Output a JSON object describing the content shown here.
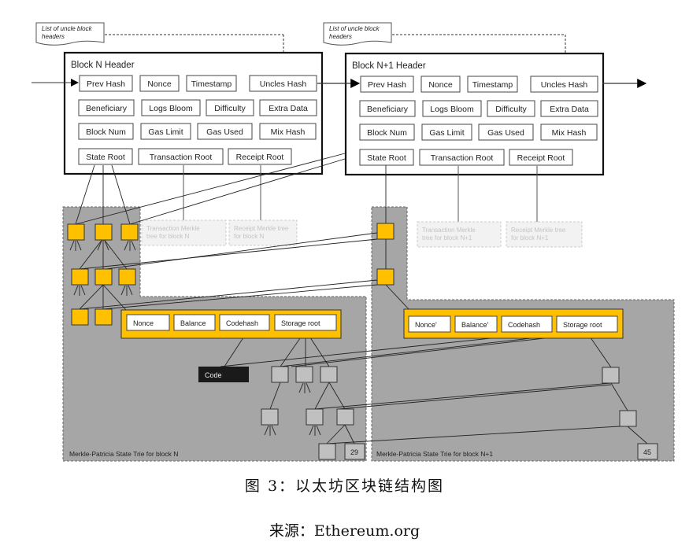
{
  "notes": [
    {
      "lines": [
        "List of uncle block",
        "headers"
      ]
    },
    {
      "lines": [
        "List of uncle block",
        "headers"
      ]
    }
  ],
  "blocks": [
    {
      "title": "Block N Header",
      "fields": [
        "Prev Hash",
        "Nonce",
        "Timestamp",
        "Uncles Hash",
        "Beneficiary",
        "Logs Bloom",
        "Difficulty",
        "Extra Data",
        "Block Num",
        "Gas Limit",
        "Gas Used",
        "Mix Hash",
        "State Root",
        "Transaction Root",
        "Receipt Root"
      ]
    },
    {
      "title": "Block N+1 Header",
      "fields": [
        "Prev Hash",
        "Nonce",
        "Timestamp",
        "Uncles Hash",
        "Beneficiary",
        "Logs Bloom",
        "Difficulty",
        "Extra Data",
        "Block Num",
        "Gas Limit",
        "Gas Used",
        "Mix Hash",
        "State Root",
        "Transaction Root",
        "Receipt Root"
      ]
    }
  ],
  "merkle_boxes": [
    {
      "lines": [
        "Transaction Merkle",
        "tree for block N"
      ]
    },
    {
      "lines": [
        "Receipt Merkle tree",
        "for block N"
      ]
    },
    {
      "lines": [
        "Transaction Merkle",
        "tree for block N+1"
      ]
    },
    {
      "lines": [
        "Receipt Merkle tree",
        "for block N+1"
      ]
    }
  ],
  "accounts": [
    [
      "Nonce",
      "Balance",
      "Codehash",
      "Storage root"
    ],
    [
      "Nonce'",
      "Balance'",
      "Codehash",
      "Storage root"
    ]
  ],
  "code_label": "Code",
  "leaf_values": [
    "29",
    "45"
  ],
  "trie_labels": [
    "Merkle-Patricia  State Trie for block N",
    "Merkle-Patricia  State Trie for block N+1"
  ],
  "caption": "图 3：以太坊区块链结构图",
  "source": "来源：Ethereum.org",
  "colors": {
    "trie_bg": "#a6a6a6",
    "node_orange": "#ffc000",
    "node_gray": "#c0c0c0",
    "code_bg": "#1a1a1a",
    "merkle_box": "#f2f2f2"
  }
}
